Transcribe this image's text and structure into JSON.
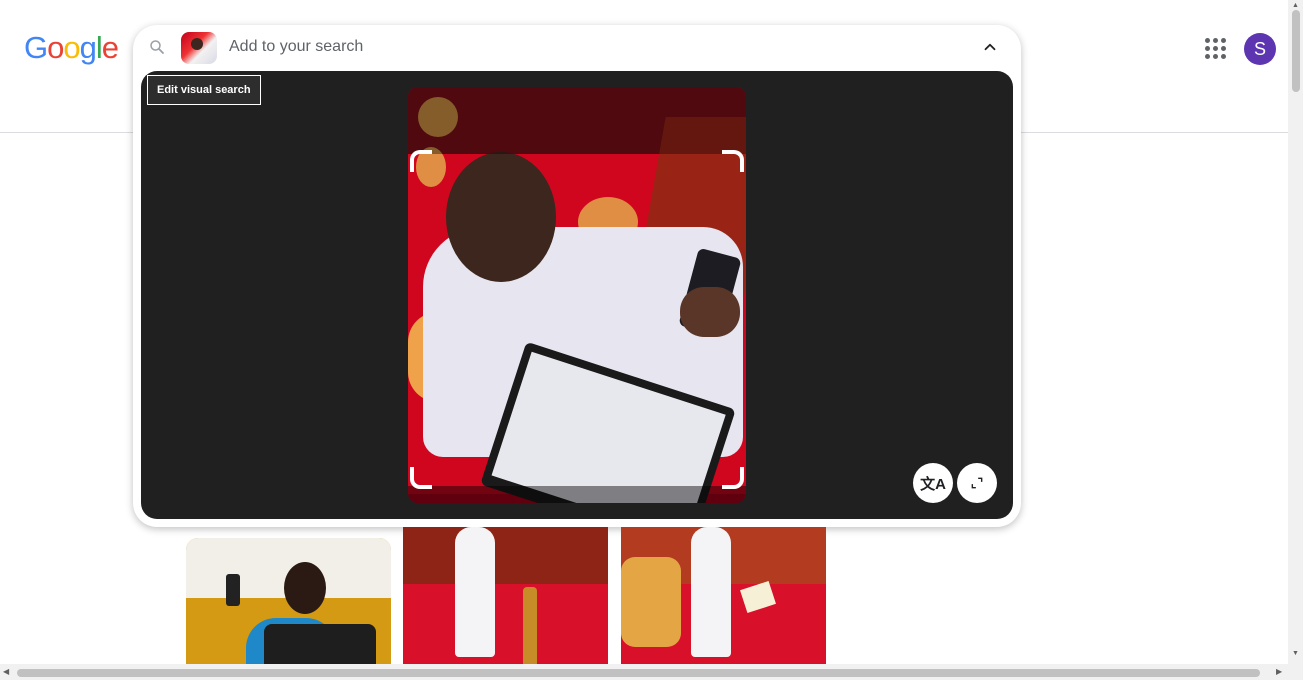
{
  "logo": {
    "letters": [
      "G",
      "o",
      "o",
      "g",
      "l",
      "e"
    ],
    "colors": [
      "#4285F4",
      "#EA4335",
      "#FBBC05",
      "#4285F4",
      "#34A853",
      "#EA4335"
    ]
  },
  "search": {
    "placeholder": "Add to your search",
    "tooltip": "Edit visual search",
    "icon": "search-icon",
    "collapse_icon": "chevron-up-icon"
  },
  "header": {
    "apps_icon": "apps-grid-icon",
    "avatar_initial": "S",
    "avatar_color": "#5e35b1"
  },
  "preview": {
    "translate_icon": "translate-icon",
    "translate_glyph": "文A",
    "expand_icon": "expand-icon"
  },
  "results": {
    "thumbnails": [
      "result-image-1",
      "result-image-2",
      "result-image-3"
    ]
  }
}
